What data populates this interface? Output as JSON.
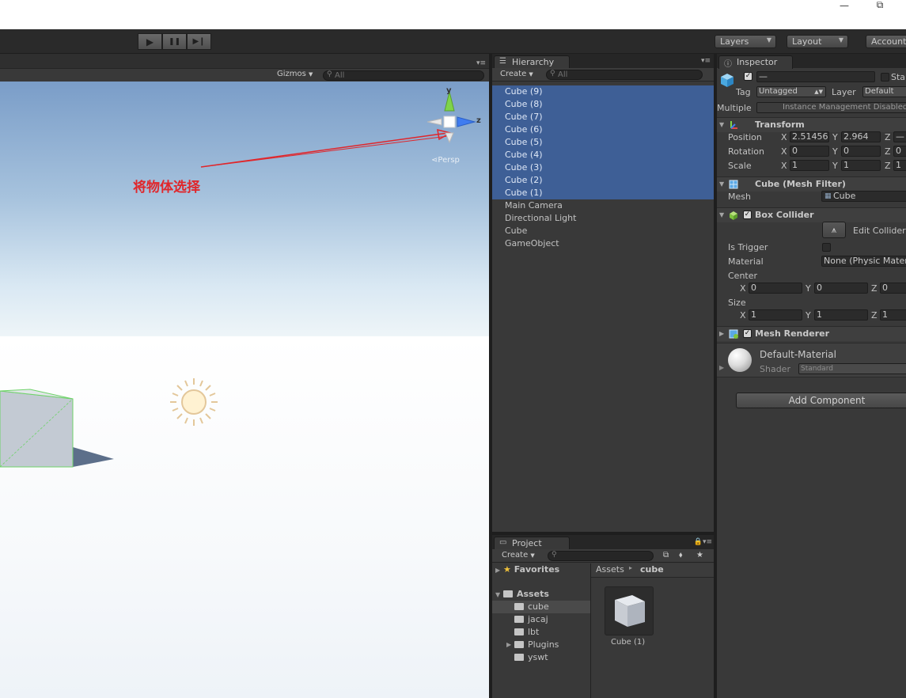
{
  "window": {
    "minimize_glyph": "—",
    "restore_glyph": "⧉"
  },
  "toolbar": {
    "play_glyph": "▶",
    "pause_glyph": "❚❚",
    "step_glyph": "▶❙",
    "layers_label": "Layers",
    "layout_label": "Layout",
    "account_label": "Account"
  },
  "scene": {
    "gizmos_label": "Gizmos",
    "search_placeholder": "All",
    "gizmo_y": "y",
    "gizmo_z": "z",
    "persp_label": "Persp",
    "annotation_text": "将物体选择",
    "annotation_color": "#e0262b"
  },
  "hierarchy": {
    "tab_label": "Hierarchy",
    "create_label": "Create",
    "search_placeholder": "All",
    "items": [
      {
        "label": "Cube (9)",
        "selected": true
      },
      {
        "label": "Cube (8)",
        "selected": true
      },
      {
        "label": "Cube (7)",
        "selected": true
      },
      {
        "label": "Cube (6)",
        "selected": true
      },
      {
        "label": "Cube (5)",
        "selected": true
      },
      {
        "label": "Cube (4)",
        "selected": true
      },
      {
        "label": "Cube (3)",
        "selected": true
      },
      {
        "label": "Cube (2)",
        "selected": true
      },
      {
        "label": "Cube (1)",
        "selected": true
      },
      {
        "label": "Main Camera",
        "selected": false
      },
      {
        "label": "Directional Light",
        "selected": false
      },
      {
        "label": "Cube",
        "selected": false
      },
      {
        "label": "GameObject",
        "selected": false
      }
    ],
    "selection_color": "#3e5f96"
  },
  "project": {
    "tab_label": "Project",
    "create_label": "Create",
    "favorites_label": "Favorites",
    "assets_label": "Assets",
    "folders": [
      "cube",
      "jacaj",
      "lbt",
      "Plugins",
      "yswt"
    ],
    "breadcrumb_root": "Assets",
    "breadcrumb_current": "cube",
    "asset_name": "Cube (1)"
  },
  "inspector": {
    "tab_label": "Inspector",
    "name_value": "—",
    "static_label": "Sta",
    "tag_label": "Tag",
    "tag_value": "Untagged",
    "layer_label": "Layer",
    "layer_value": "Default",
    "multiple_label": "Multiple",
    "multiple_value": "Instance Management Disabled",
    "transform": {
      "title": "Transform",
      "position_label": "Position",
      "pos_x": "2.51456",
      "pos_y": "2.964",
      "pos_z": "—",
      "rotation_label": "Rotation",
      "rot_x": "0",
      "rot_y": "0",
      "rot_z": "0",
      "scale_label": "Scale",
      "scale_x": "1",
      "scale_y": "1",
      "scale_z": "1"
    },
    "mesh_filter": {
      "title": "Cube (Mesh Filter)",
      "mesh_label": "Mesh",
      "mesh_value": "Cube"
    },
    "box_collider": {
      "title": "Box Collider",
      "edit_label": "Edit Collider",
      "is_trigger_label": "Is Trigger",
      "material_label": "Material",
      "material_value": "None (Physic Material)",
      "center_label": "Center",
      "center_x": "0",
      "center_y": "0",
      "center_z": "0",
      "size_label": "Size",
      "size_x": "1",
      "size_y": "1",
      "size_z": "1"
    },
    "mesh_renderer": {
      "title": "Mesh Renderer"
    },
    "material": {
      "name": "Default-Material",
      "shader_label": "Shader",
      "shader_value": "Standard"
    },
    "add_component_label": "Add Component",
    "axis_x": "X",
    "axis_y": "Y",
    "axis_z": "Z"
  }
}
